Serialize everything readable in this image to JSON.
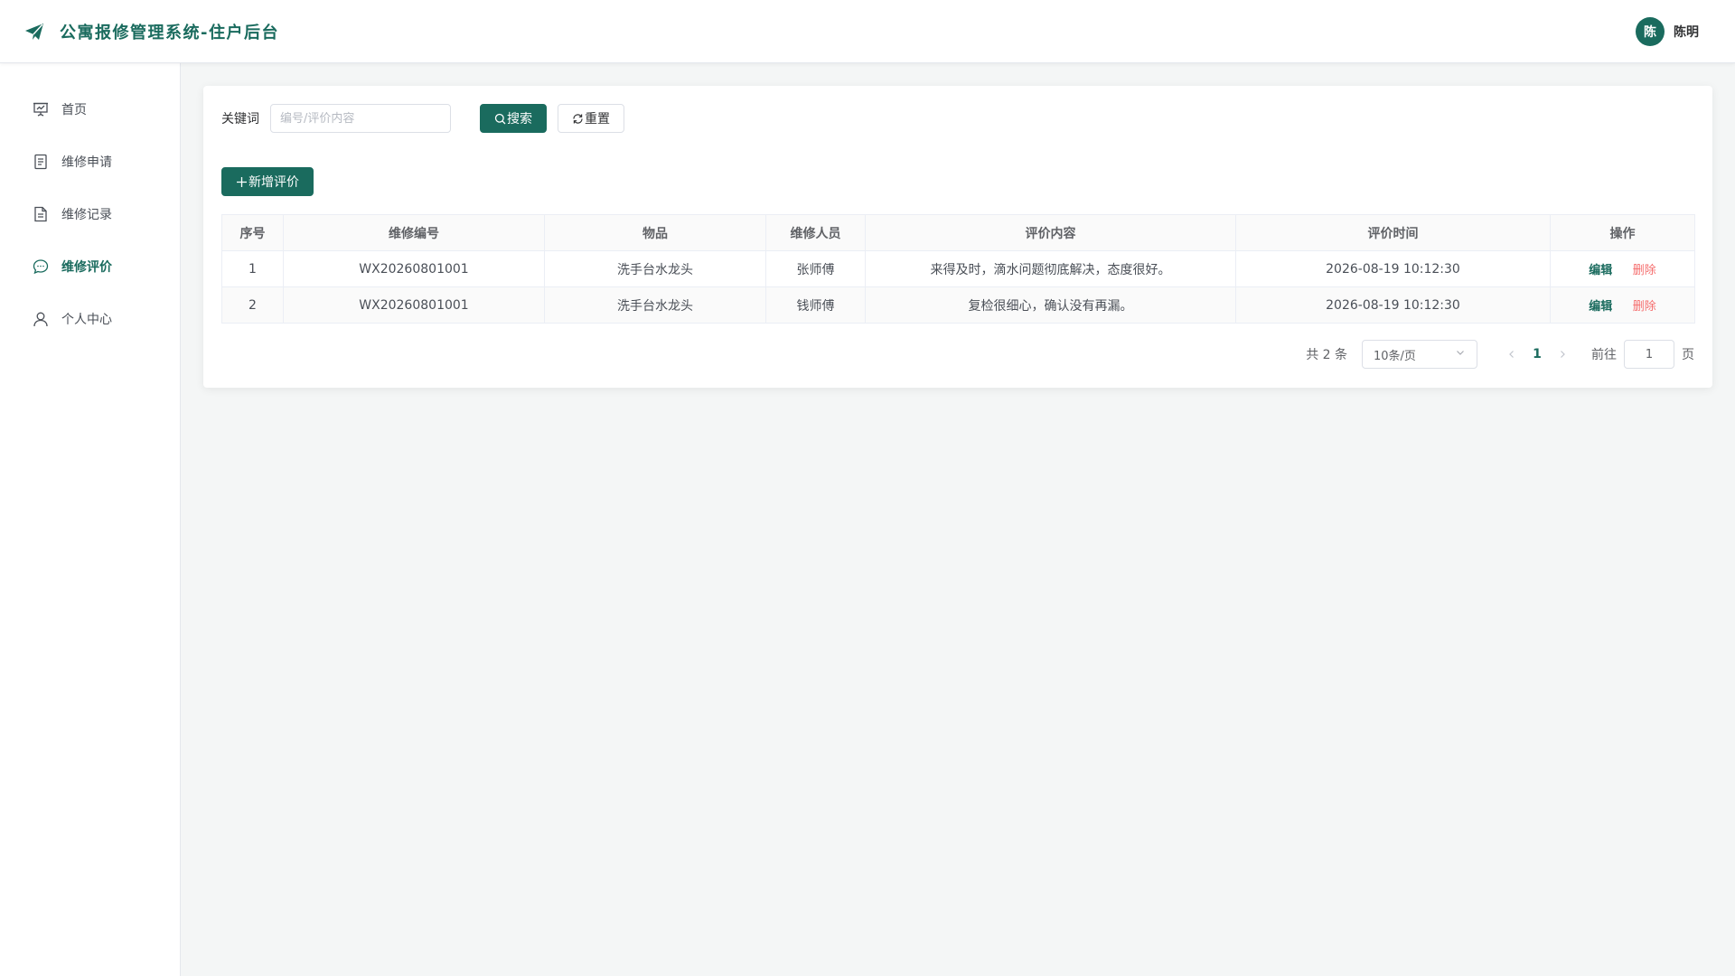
{
  "header": {
    "app_title": "公寓报修管理系统-住户后台",
    "avatar_text": "陈",
    "user_name": "陈明"
  },
  "colors": {
    "primary": "#1a6b5e",
    "danger": "#f56c6c",
    "background": "#f4f6f6"
  },
  "sidebar": {
    "items": [
      {
        "label": "首页",
        "icon": "presentation-board-icon",
        "active": false
      },
      {
        "label": "维修申请",
        "icon": "document-list-icon",
        "active": false
      },
      {
        "label": "维修记录",
        "icon": "file-record-icon",
        "active": false
      },
      {
        "label": "维修评价",
        "icon": "chat-bubble-icon",
        "active": true
      },
      {
        "label": "个人中心",
        "icon": "user-icon",
        "active": false
      }
    ]
  },
  "filter": {
    "keyword_label": "关键词",
    "keyword_placeholder": "编号/评价内容",
    "keyword_value": "",
    "search_label": "搜索",
    "reset_label": "重置"
  },
  "toolbar": {
    "add_label": "新增评价"
  },
  "table": {
    "columns": [
      "序号",
      "维修编号",
      "物品",
      "维修人员",
      "评价内容",
      "评价时间",
      "操作"
    ],
    "rows": [
      {
        "index": "1",
        "repair_no": "WX20260801001",
        "item": "洗手台水龙头",
        "worker": "张师傅",
        "content": "来得及时，滴水问题彻底解决，态度很好。",
        "time": "2026-08-19 10:12:30",
        "edit_label": "编辑",
        "delete_label": "删除"
      },
      {
        "index": "2",
        "repair_no": "WX20260801001",
        "item": "洗手台水龙头",
        "worker": "钱师傅",
        "content": "复检很细心，确认没有再漏。",
        "time": "2026-08-19 10:12:30",
        "edit_label": "编辑",
        "delete_label": "删除"
      }
    ]
  },
  "pagination": {
    "total_text": "共 2 条",
    "page_size": "10条/页",
    "current_page": "1",
    "goto_label": "前往",
    "goto_value": "1",
    "page_unit": "页"
  }
}
